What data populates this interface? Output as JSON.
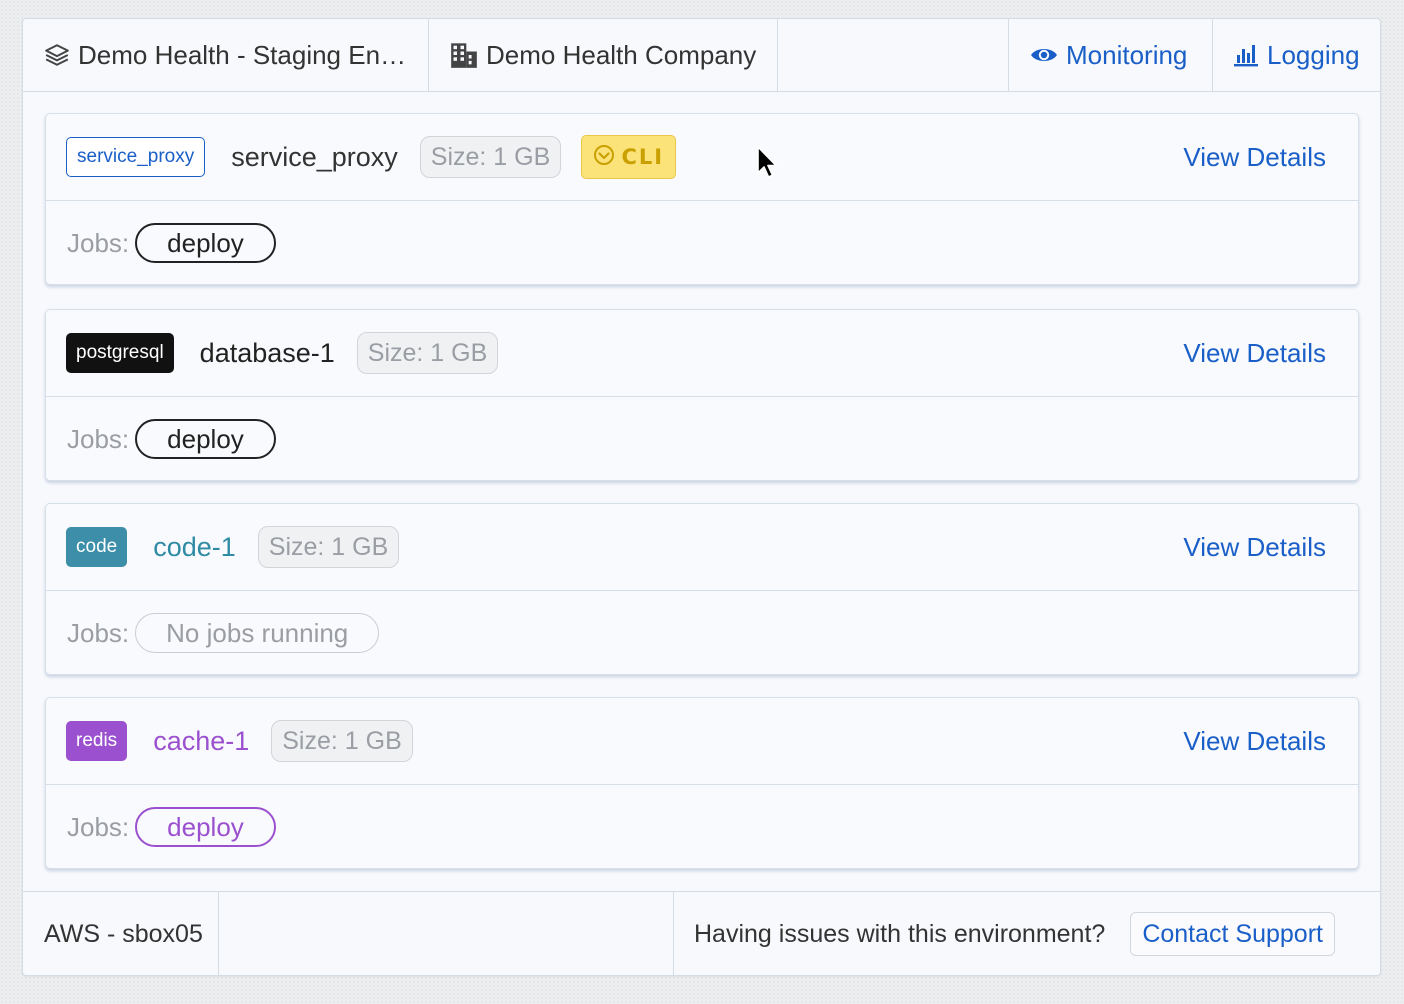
{
  "topbar": {
    "environment": "Demo Health - Staging En…",
    "company": "Demo Health Company",
    "monitoring": "Monitoring",
    "logging": "Logging"
  },
  "services": [
    {
      "type_label": "service_proxy",
      "name": "service_proxy",
      "size": "Size: 1 GB",
      "cli_badge": "CLI",
      "view_details": "View Details",
      "jobs_label": "Jobs:",
      "job": "deploy",
      "colors": {
        "badge_border": "#1a5fc8",
        "badge_text": "#1a5fc8",
        "name": "#333333",
        "job": "#222222"
      }
    },
    {
      "type_label": "postgresql",
      "name": "database-1",
      "size": "Size: 1 GB",
      "view_details": "View Details",
      "jobs_label": "Jobs:",
      "job": "deploy",
      "colors": {
        "badge_bg": "#111111",
        "badge_text": "#ffffff",
        "name": "#222222",
        "job": "#222222"
      }
    },
    {
      "type_label": "code",
      "name": "code-1",
      "size": "Size: 1 GB",
      "view_details": "View Details",
      "jobs_label": "Jobs:",
      "job": "No jobs running",
      "colors": {
        "badge_bg": "#3d8ea8",
        "badge_text": "#ffffff",
        "name": "#2e8ba3",
        "job": "#9a9da2"
      }
    },
    {
      "type_label": "redis",
      "name": "cache-1",
      "size": "Size: 1 GB",
      "view_details": "View Details",
      "jobs_label": "Jobs:",
      "job": "deploy",
      "colors": {
        "badge_bg": "#9b51cf",
        "badge_text": "#ffffff",
        "name": "#9b51cf",
        "job": "#9b51cf"
      }
    }
  ],
  "footer": {
    "region": "AWS - sbox05",
    "issues_text": "Having issues with this environment?",
    "contact": "Contact Support"
  }
}
